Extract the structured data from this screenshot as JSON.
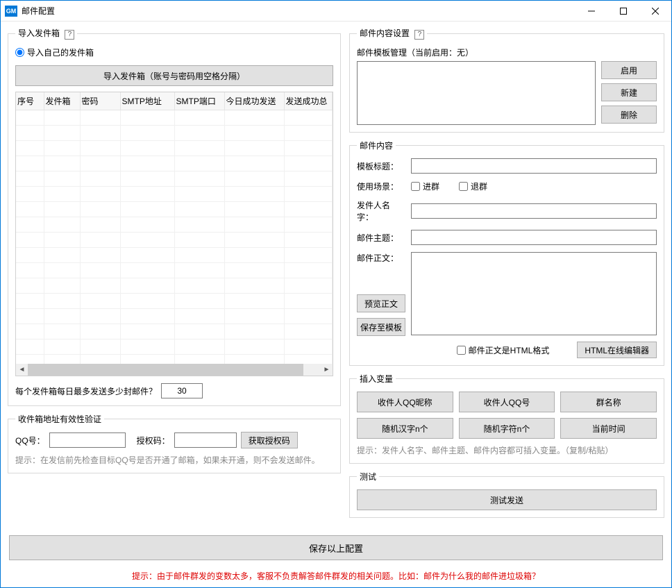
{
  "window": {
    "title": "邮件配置",
    "icon_text": "GM"
  },
  "left": {
    "import_section_title": "导入发件箱",
    "radio_label": "导入自己的发件箱",
    "import_button": "导入发件箱（账号与密码用空格分隔）",
    "table_headers": [
      "序号",
      "发件箱",
      "密码",
      "SMTP地址",
      "SMTP端口",
      "今日成功发送",
      "发送成功总"
    ],
    "max_send_label": "每个发件箱每日最多发送多少封邮件？",
    "max_send_value": "30",
    "validation_section_title": "收件箱地址有效性验证",
    "qq_label": "QQ号：",
    "auth_label": "授权码：",
    "auth_button": "获取授权码",
    "validation_tip": "提示：在发信前先检查目标QQ号是否开通了邮箱，如果未开通，则不会发送邮件。"
  },
  "right": {
    "content_section_title": "邮件内容设置",
    "template_label": "邮件模板管理（当前启用：无）",
    "btn_enable": "启用",
    "btn_new": "新建",
    "btn_delete": "删除",
    "mail_content_title": "邮件内容",
    "lbl_template_title": "模板标题：",
    "lbl_scene": "使用场景：",
    "chk_join": "进群",
    "chk_leave": "退群",
    "lbl_sender": "发件人名字：",
    "lbl_subject": "邮件主题：",
    "lbl_body": "邮件正文：",
    "btn_preview": "预览正文",
    "btn_save_template": "保存至模板",
    "chk_html": "邮件正文是HTML格式",
    "btn_html_editor": "HTML在线编辑器",
    "vars_section_title": "插入变量",
    "var_btns": [
      "收件人QQ昵称",
      "收件人QQ号",
      "群名称",
      "随机汉字n个",
      "随机字符n个",
      "当前时间"
    ],
    "vars_tip": "提示：发件人名字、邮件主题、邮件内容都可插入变量。（复制/粘贴）",
    "test_section_title": "测试",
    "btn_test_send": "测试发送"
  },
  "save_button": "保存以上配置",
  "bottom_tip": "提示：由于邮件群发的变数太多，客服不负责解答邮件群发的相关问题。比如：邮件为什么我的邮件进垃圾箱？"
}
